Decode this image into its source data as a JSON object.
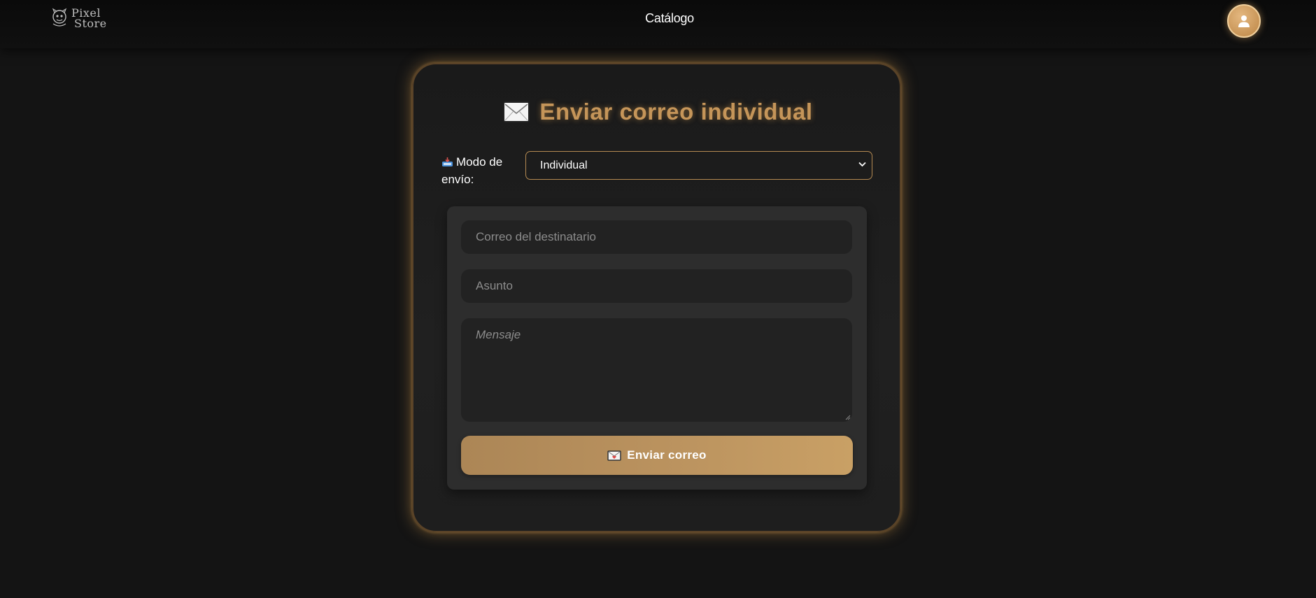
{
  "navbar": {
    "logo_lines": [
      "Pixel",
      "Store"
    ],
    "catalog_link": "Catálogo",
    "avatar_icon": "user-icon"
  },
  "card": {
    "title": "Enviar correo individual",
    "title_icon": "envelope-icon",
    "mode": {
      "label": "Modo de envío:",
      "icon": "inbox-tray-icon",
      "selected": "Individual"
    },
    "form": {
      "email_placeholder": "Correo del destinatario",
      "subject_placeholder": "Asunto",
      "message_placeholder": "Mensaje",
      "submit_label": "Enviar correo",
      "submit_icon": "love-letter-icon"
    }
  },
  "colors": {
    "accent": "#c59559",
    "background": "#141414",
    "panel": "#2d2d2d",
    "field": "#222222"
  }
}
